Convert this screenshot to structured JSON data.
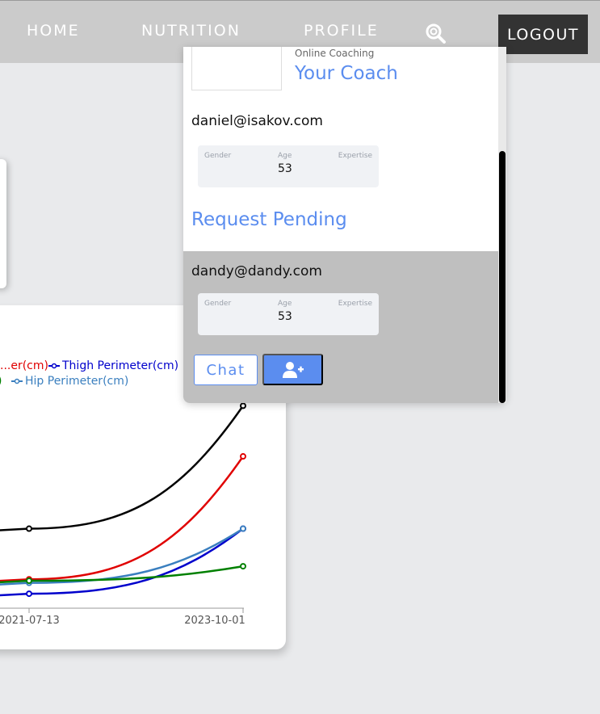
{
  "nav": {
    "home": "HOME",
    "nutrition": "NUTRITION",
    "profile": "PROFILE",
    "search_icon": "search-icon",
    "logout": "LOGOUT"
  },
  "coach_panel": {
    "subtitle": "Online Coaching",
    "title": "Your Coach",
    "coaches": [
      {
        "email": "daniel@isakov.com",
        "stats": {
          "gender_label": "Gender",
          "age_label": "Age",
          "expertise_label": "Expertise",
          "age": "53"
        },
        "status": "Request Pending"
      },
      {
        "email": "dandy@dandy.com",
        "stats": {
          "gender_label": "Gender",
          "age_label": "Age",
          "expertise_label": "Expertise",
          "age": "53"
        },
        "chat_label": "Chat",
        "add_icon": "add-user-icon"
      }
    ]
  },
  "colors": {
    "accent": "#5b8def",
    "navbar": "#cbcbcb",
    "logout_bg": "#333333",
    "highlight_row": "#bfbfbf"
  },
  "chart_data": {
    "type": "line",
    "legend": [
      "...er(cm)",
      "Thigh Perimeter(cm)",
      "Hip Perimeter(cm)"
    ],
    "x": [
      "2021-07-13",
      "2023-10-01"
    ],
    "series": [
      {
        "name": "",
        "color": "#000000",
        "values": [
          11,
          28
        ]
      },
      {
        "name": "...er(cm)",
        "color": "#e00000",
        "values": [
          4,
          21
        ]
      },
      {
        "name": "Thigh Perimeter(cm)",
        "color": "#0000cc",
        "values": [
          2,
          11
        ]
      },
      {
        "name": "Hip Perimeter(cm)",
        "color": "#3a7fbf",
        "values": [
          3.5,
          11
        ]
      },
      {
        "name": "",
        "color": "#008000",
        "values": [
          3.8,
          5.8
        ]
      }
    ],
    "xlabel": "",
    "ylabel": ""
  }
}
